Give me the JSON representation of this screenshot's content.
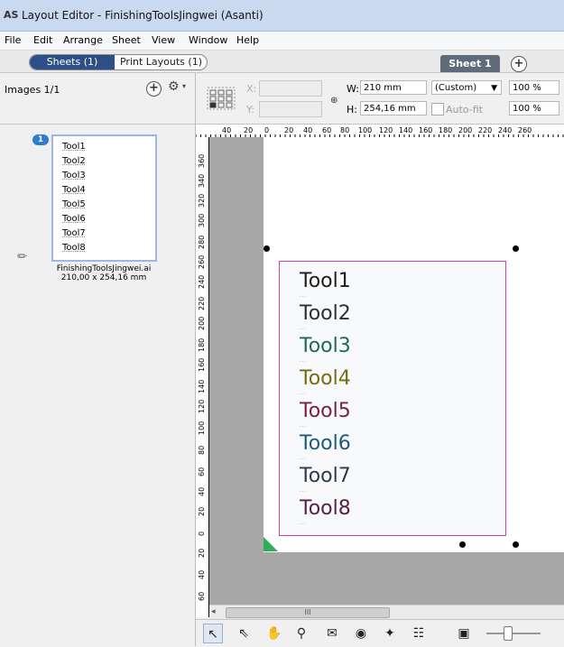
{
  "window": {
    "logo": "AS",
    "title": "Layout Editor - FinishingToolsJingwei (Asanti)"
  },
  "menu": [
    "File",
    "Edit",
    "Arrange",
    "Sheet",
    "View",
    "Window",
    "Help"
  ],
  "tabs": {
    "sheets": "Sheets (1)",
    "print_layouts": "Print Layouts (1)",
    "sheet_tab": "Sheet 1",
    "add": "+"
  },
  "left_panel": {
    "images_label": "Images 1/1",
    "add": "+",
    "gear": "⚙",
    "caret": "▾",
    "badge": "1",
    "thumb_items": [
      "Tool1",
      "Tool2",
      "Tool3",
      "Tool4",
      "Tool5",
      "Tool6",
      "Tool7",
      "Tool8"
    ],
    "file_name": "FinishingToolsJingwei.ai",
    "file_size": "210,00 x 254,16 mm"
  },
  "toolbar": {
    "x_label": "X:",
    "y_label": "Y:",
    "w_label": "W:",
    "h_label": "H:",
    "width": "210 mm",
    "height": "254,16 mm",
    "preset": "(Custom)",
    "autofit": "Auto-fit",
    "scale_w": "100 %",
    "scale_h": "100 %"
  },
  "ruler": {
    "h": [
      "40",
      "20",
      "0",
      "20",
      "40",
      "60",
      "80",
      "100",
      "120",
      "140",
      "160",
      "180",
      "200",
      "220",
      "240",
      "260"
    ],
    "v": [
      "360",
      "340",
      "320",
      "300",
      "280",
      "260",
      "240",
      "220",
      "200",
      "180",
      "160",
      "140",
      "120",
      "100",
      "80",
      "60",
      "40",
      "20",
      "0",
      "20",
      "40",
      "60"
    ]
  },
  "artwork": {
    "tools": [
      {
        "name": "Tool1",
        "color": "#1e1e1e",
        "sub": "..."
      },
      {
        "name": "Tool2",
        "color": "#2a2e36",
        "sub": "..."
      },
      {
        "name": "Tool3",
        "color": "#1e6b55",
        "sub": "..."
      },
      {
        "name": "Tool4",
        "color": "#7a6a13",
        "sub": "..."
      },
      {
        "name": "Tool5",
        "color": "#7a1e4a",
        "sub": "..."
      },
      {
        "name": "Tool6",
        "color": "#1e5b7a",
        "sub": "..."
      },
      {
        "name": "Tool7",
        "color": "#2e3a4e",
        "sub": "..."
      },
      {
        "name": "Tool8",
        "color": "#5a1e46",
        "sub": "..."
      }
    ]
  },
  "scrollbar": {
    "left_arrow": "◂",
    "thumb": "III"
  },
  "bottom_tools": [
    "↖",
    "⇖",
    "✋",
    "⚲",
    "✉",
    "◉",
    "✦",
    "☷",
    "▣"
  ],
  "colors": {
    "selected_tab": "#2d4e86",
    "sheet_tab": "#5f6b78",
    "art_border": "#d63ea4",
    "badge": "#2f7dd2",
    "corner_mark": "#2fae5a"
  }
}
